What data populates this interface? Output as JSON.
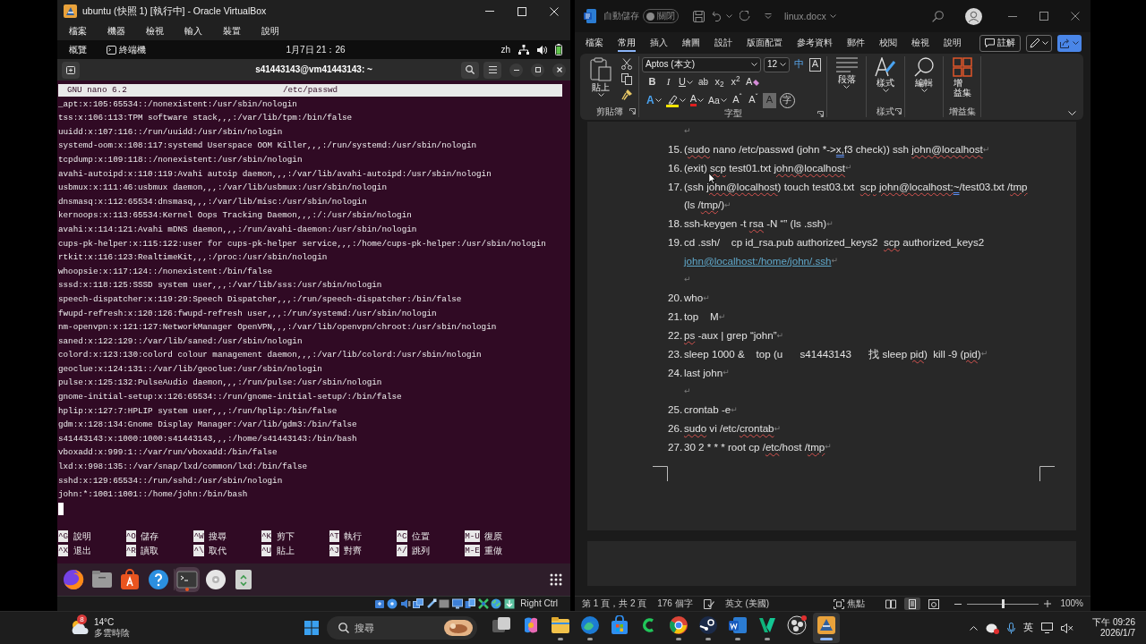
{
  "virtualbox": {
    "title": "ubuntu (快照 1) [執行中] - Oracle VirtualBox",
    "menu": [
      "檔案",
      "機器",
      "檢視",
      "輸入",
      "裝置",
      "說明"
    ],
    "host_key": "Right Ctrl"
  },
  "ubuntu": {
    "topbar": {
      "activities": "概覽",
      "app": "終端機",
      "clock": "1月7日 21：26",
      "input_method": "zh"
    },
    "terminal_title": "s41443143@vm41443143: ~",
    "nano": {
      "version": "GNU nano 6.2",
      "file": "/etc/passwd",
      "lines": [
        "_apt:x:105:65534::/nonexistent:/usr/sbin/nologin",
        "tss:x:106:113:TPM software stack,,,:/var/lib/tpm:/bin/false",
        "uuidd:x:107:116::/run/uuidd:/usr/sbin/nologin",
        "systemd-oom:x:108:117:systemd Userspace OOM Killer,,,:/run/systemd:/usr/sbin/nologin",
        "tcpdump:x:109:118::/nonexistent:/usr/sbin/nologin",
        "avahi-autoipd:x:110:119:Avahi autoip daemon,,,:/var/lib/avahi-autoipd:/usr/sbin/nologin",
        "usbmux:x:111:46:usbmux daemon,,,:/var/lib/usbmux:/usr/sbin/nologin",
        "dnsmasq:x:112:65534:dnsmasq,,,:/var/lib/misc:/usr/sbin/nologin",
        "kernoops:x:113:65534:Kernel Oops Tracking Daemon,,,:/:/usr/sbin/nologin",
        "avahi:x:114:121:Avahi mDNS daemon,,,:/run/avahi-daemon:/usr/sbin/nologin",
        "cups-pk-helper:x:115:122:user for cups-pk-helper service,,,:/home/cups-pk-helper:/usr/sbin/nologin",
        "rtkit:x:116:123:RealtimeKit,,,:/proc:/usr/sbin/nologin",
        "whoopsie:x:117:124::/nonexistent:/bin/false",
        "sssd:x:118:125:SSSD system user,,,:/var/lib/sss:/usr/sbin/nologin",
        "speech-dispatcher:x:119:29:Speech Dispatcher,,,:/run/speech-dispatcher:/bin/false",
        "fwupd-refresh:x:120:126:fwupd-refresh user,,,:/run/systemd:/usr/sbin/nologin",
        "nm-openvpn:x:121:127:NetworkManager OpenVPN,,,:/var/lib/openvpn/chroot:/usr/sbin/nologin",
        "saned:x:122:129::/var/lib/saned:/usr/sbin/nologin",
        "colord:x:123:130:colord colour management daemon,,,:/var/lib/colord:/usr/sbin/nologin",
        "geoclue:x:124:131::/var/lib/geoclue:/usr/sbin/nologin",
        "pulse:x:125:132:PulseAudio daemon,,,:/run/pulse:/usr/sbin/nologin",
        "gnome-initial-setup:x:126:65534::/run/gnome-initial-setup/:/bin/false",
        "hplip:x:127:7:HPLIP system user,,,:/run/hplip:/bin/false",
        "gdm:x:128:134:Gnome Display Manager:/var/lib/gdm3:/bin/false",
        "s41443143:x:1000:1000:s41443143,,,:/home/s41443143:/bin/bash",
        "vboxadd:x:999:1::/var/run/vboxadd:/bin/false",
        "lxd:x:998:135::/var/snap/lxd/common/lxd:/bin/false",
        "sshd:x:129:65534::/run/sshd:/usr/sbin/nologin",
        "john:*:1001:1001::/home/john:/bin/bash"
      ],
      "shortcuts": [
        {
          "key": "^G",
          "label": "說明"
        },
        {
          "key": "^O",
          "label": "儲存"
        },
        {
          "key": "^W",
          "label": "搜尋"
        },
        {
          "key": "^K",
          "label": "剪下"
        },
        {
          "key": "^T",
          "label": "執行"
        },
        {
          "key": "^C",
          "label": "位置"
        },
        {
          "key": "M-U",
          "label": "復原"
        },
        {
          "key": "^X",
          "label": "退出"
        },
        {
          "key": "^R",
          "label": "讀取"
        },
        {
          "key": "^\\",
          "label": "取代"
        },
        {
          "key": "^U",
          "label": "貼上"
        },
        {
          "key": "^J",
          "label": "對齊"
        },
        {
          "key": "^/",
          "label": "跳列"
        },
        {
          "key": "M-E",
          "label": "重做"
        }
      ]
    },
    "dock": [
      {
        "active": false
      },
      {
        "active": false
      },
      {
        "active": false
      },
      {
        "active": false
      },
      {
        "active": true
      },
      {
        "active": false
      },
      {
        "active": false
      }
    ]
  },
  "word": {
    "autosave": {
      "label": "自動儲存",
      "on": false,
      "state": "關閉"
    },
    "file_name": "linux.docx",
    "tabs": [
      {
        "label": "檔案",
        "selected": false
      },
      {
        "label": "常用",
        "selected": true
      },
      {
        "label": "插入",
        "selected": false
      },
      {
        "label": "繪圖",
        "selected": false
      },
      {
        "label": "設計",
        "selected": false
      },
      {
        "label": "版面配置",
        "selected": false
      },
      {
        "label": "參考資料",
        "selected": false
      },
      {
        "label": "郵件",
        "selected": false
      },
      {
        "label": "校閱",
        "selected": false
      },
      {
        "label": "檢視",
        "selected": false
      },
      {
        "label": "說明",
        "selected": false
      }
    ],
    "comments": "註解",
    "ribbon": {
      "clipboard": {
        "paste": "貼上",
        "group": "剪貼簿"
      },
      "font": {
        "name": "Aptos (本文)",
        "size": "12",
        "group": "字型",
        "row1": [
          {
            "kind": "phonetic",
            "label": "中",
            "dropdown": false
          },
          {
            "kind": "border",
            "label": "A",
            "dropdown": false
          }
        ],
        "row2": [
          {
            "kind": "bold",
            "label": "B",
            "dropdown": false
          },
          {
            "kind": "italic",
            "label": "I",
            "dropdown": false
          },
          {
            "kind": "underline",
            "label": "U",
            "dropdown": true
          },
          {
            "kind": "strike",
            "label": "ab",
            "dropdown": false
          },
          {
            "kind": "subscript",
            "label": "x$_{2}$",
            "dropdown": false
          },
          {
            "kind": "superscript",
            "label": "x$^{2}$",
            "dropdown": false
          },
          {
            "kind": "clear",
            "label": "A",
            "dropdown": false
          }
        ],
        "row3": [
          {
            "kind": "effects",
            "label": "A",
            "dropdown": true
          },
          {
            "kind": "highlight",
            "dropdown": true
          },
          {
            "kind": "color",
            "label": "A",
            "dropdown": true
          },
          {
            "kind": "case",
            "label": "Aa",
            "dropdown": true
          },
          {
            "kind": "grow",
            "label": "A$^{ˆ}$",
            "dropdown": false
          },
          {
            "kind": "shrink",
            "label": "A$^{ˇ}$",
            "dropdown": false
          },
          {
            "kind": "shading",
            "label": "A",
            "dropdown": false
          },
          {
            "kind": "enclose",
            "label": "字",
            "dropdown": false
          }
        ]
      },
      "paragraph": {
        "button": "段落"
      },
      "styles": {
        "button": "樣式",
        "group": "樣式"
      },
      "editing": {
        "button": "編輯"
      },
      "addins": {
        "button": [
          "增",
          "益集"
        ],
        "group": "增益集"
      }
    },
    "document": {
      "paragraphs": [
        {
          "kind": "empty",
          "mark": "↵"
        },
        {
          "kind": "item",
          "number": "15.",
          "mark": "↵",
          "lines": [
            [
              {
                "kind": "plain",
                "text": "("
              },
              {
                "kind": "spelling",
                "text": "sudo"
              },
              {
                "kind": "plain",
                "text": " nano /etc/passwd (john *->"
              },
              {
                "kind": "grammar",
                "text": "x,"
              },
              {
                "kind": "plain",
                "text": "f3 check)) ssh "
              },
              {
                "kind": "spelling",
                "text": "john@localhost"
              }
            ]
          ]
        },
        {
          "kind": "item",
          "number": "16.",
          "mark": "↵",
          "lines": [
            [
              {
                "kind": "plain",
                "text": "(exit) "
              },
              {
                "kind": "spelling",
                "text": "scp"
              },
              {
                "kind": "plain",
                "text": " test01.txt "
              },
              {
                "kind": "spelling",
                "text": "john@localhost"
              }
            ]
          ]
        },
        {
          "kind": "item",
          "number": "17.",
          "mark": "↵",
          "lines": [
            [
              {
                "kind": "plain",
                "text": "(ssh "
              },
              {
                "kind": "spelling",
                "text": "john@localhost"
              },
              {
                "kind": "plain",
                "text": ") touch test03.txt  "
              },
              {
                "kind": "spelling",
                "text": "scp"
              },
              {
                "kind": "spelling",
                "text": " john@localhost:"
              },
              {
                "kind": "grammar",
                "text": "~"
              },
              {
                "kind": "plain",
                "text": "/test03.txt /"
              },
              {
                "kind": "spelling",
                "text": "tmp"
              }
            ],
            [
              {
                "kind": "plain",
                "text": "(ls /"
              },
              {
                "kind": "spelling",
                "text": "tmp"
              },
              {
                "kind": "plain",
                "text": "/)"
              }
            ]
          ]
        },
        {
          "kind": "item",
          "number": "18.",
          "mark": "↵",
          "lines": [
            [
              {
                "kind": "plain",
                "text": "ssh-keygen -t "
              },
              {
                "kind": "spelling",
                "text": "rsa"
              },
              {
                "kind": "plain",
                "text": " -N “” (ls .ssh)"
              }
            ]
          ]
        },
        {
          "kind": "item",
          "number": "19.",
          "mark": "↵",
          "lines": [
            [
              {
                "kind": "plain",
                "text": "cd .ssh/    cp id_rsa.pub authorized_keys2  "
              },
              {
                "kind": "spelling",
                "text": "scp"
              },
              {
                "kind": "plain",
                "text": " authorized_keys2"
              }
            ],
            [
              {
                "kind": "link",
                "text": "john@localhost:/home/john/.ssh"
              }
            ]
          ]
        },
        {
          "kind": "empty",
          "mark": "↵"
        },
        {
          "kind": "item",
          "number": "20.",
          "mark": "↵",
          "lines": [
            [
              {
                "kind": "plain",
                "text": "who"
              }
            ]
          ]
        },
        {
          "kind": "item",
          "number": "21.",
          "mark": "↵",
          "lines": [
            [
              {
                "kind": "plain",
                "text": "top    M"
              }
            ]
          ]
        },
        {
          "kind": "item",
          "number": "22.",
          "mark": "↵",
          "lines": [
            [
              {
                "kind": "spelling",
                "text": "ps"
              },
              {
                "kind": "plain",
                "text": " -aux | grep “john”"
              }
            ]
          ]
        },
        {
          "kind": "item",
          "number": "23.",
          "mark": "↵",
          "lines": [
            [
              {
                "kind": "plain",
                "text": "sleep 1000 &    top (u      s41443143      找 sleep "
              },
              {
                "kind": "spelling",
                "text": "pid"
              },
              {
                "kind": "plain",
                "text": ")  kill -9 ("
              },
              {
                "kind": "spelling",
                "text": "pid"
              },
              {
                "kind": "plain",
                "text": ")"
              }
            ]
          ]
        },
        {
          "kind": "item",
          "number": "24.",
          "mark": "↵",
          "lines": [
            [
              {
                "kind": "plain",
                "text": "last john"
              }
            ]
          ]
        },
        {
          "kind": "empty",
          "mark": "↵"
        },
        {
          "kind": "item",
          "number": "25.",
          "mark": "↵",
          "lines": [
            [
              {
                "kind": "plain",
                "text": "crontab -e"
              }
            ]
          ]
        },
        {
          "kind": "item",
          "number": "26.",
          "mark": "↵",
          "lines": [
            [
              {
                "kind": "spelling",
                "text": "sudo"
              },
              {
                "kind": "plain",
                "text": " vi /etc/"
              },
              {
                "kind": "spelling",
                "text": "crontab"
              }
            ]
          ]
        },
        {
          "kind": "item",
          "number": "27.",
          "mark": "↵",
          "lines": [
            [
              {
                "kind": "plain",
                "text": "30 2 * * * root cp /"
              },
              {
                "kind": "spelling",
                "text": "etc"
              },
              {
                "kind": "plain",
                "text": "/host /"
              },
              {
                "kind": "spelling",
                "text": "tmp"
              }
            ]
          ]
        }
      ]
    },
    "status_bar": {
      "page": "第 1 頁，共 2 頁",
      "words": "176 個字",
      "language": "英文 (美國)",
      "focus": "焦點",
      "views": [
        {
          "selected": false
        },
        {
          "selected": true
        },
        {
          "selected": false
        }
      ],
      "zoom_slider": {
        "level": 0.5
      },
      "zoom": "100%"
    }
  },
  "taskbar": {
    "weather": {
      "badge": "8",
      "temperature": "14°C",
      "condition": "多雲時陰"
    },
    "search": {
      "placeholder": "搜尋"
    },
    "apps": [
      {
        "running": false,
        "active": false
      },
      {
        "running": false,
        "active": false
      },
      {
        "running": true,
        "active": false
      },
      {
        "running": true,
        "active": false
      },
      {
        "running": false,
        "active": false
      },
      {
        "running": false,
        "active": false
      },
      {
        "running": true,
        "active": false
      },
      {
        "running": true,
        "active": false
      },
      {
        "running": true,
        "active": false
      },
      {
        "running": true,
        "active": false
      },
      {
        "running": false,
        "active": false
      },
      {
        "running": true,
        "active": true
      }
    ],
    "input_method": "英",
    "volume": {
      "muted": true
    },
    "time": "下午 09:26",
    "date": "2026/1/7"
  }
}
